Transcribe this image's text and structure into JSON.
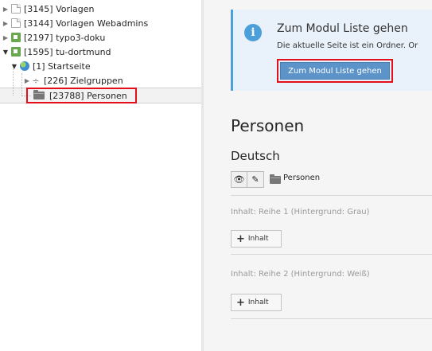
{
  "tree": {
    "items": [
      {
        "label": "[3145] Vorlagen"
      },
      {
        "label": "[3144] Vorlagen Webadmins"
      },
      {
        "label": "[2197] typo3-doku"
      },
      {
        "label": "[1595] tu-dortmund"
      },
      {
        "label": "[1] Startseite"
      },
      {
        "label": "[226] Zielgruppen"
      },
      {
        "label": "[23788] Personen"
      }
    ]
  },
  "info": {
    "title": "Zum Modul Liste gehen",
    "text": "Die aktuelle Seite ist ein Ordner. Or",
    "button_label": "Zum Modul Liste gehen"
  },
  "page": {
    "title": "Personen",
    "language": "Deutsch",
    "folder_label": "Personen"
  },
  "sections": [
    {
      "title": "Inhalt: Reihe 1 (Hintergrund: Grau)",
      "add_label": "Inhalt"
    },
    {
      "title": "Inhalt: Reihe 2 (Hintergrund: Weiß)",
      "add_label": "Inhalt"
    }
  ],
  "colors": {
    "accent": "#5c93c9",
    "highlight": "#e3101c",
    "info_bg": "#e9f2fa"
  }
}
